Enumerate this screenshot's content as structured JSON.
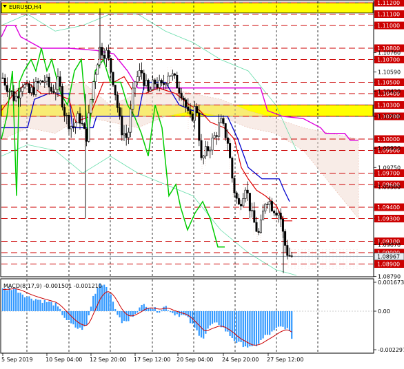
{
  "chart_window": {
    "title": "EURUSD,H4",
    "symbol": "EURUSD",
    "timeframe": "H4",
    "price_axis": {
      "plain_ticks": [
        "1.10760",
        "1.10590",
        "1.10420",
        "1.10200",
        "1.09920",
        "1.09750",
        "1.09580",
        "1.09070",
        "1.08790"
      ],
      "current_price": "1.08967"
    },
    "levels": [
      {
        "label": "1.11200",
        "value": 1.112
      },
      {
        "label": "1.11100",
        "value": 1.111
      },
      {
        "label": "1.11000",
        "value": 1.11
      },
      {
        "label": "1.10800",
        "value": 1.108
      },
      {
        "label": "1.10700",
        "value": 1.107
      },
      {
        "label": "1.10500",
        "value": 1.105
      },
      {
        "label": "1.10400",
        "value": 1.104
      },
      {
        "label": "1.10300",
        "value": 1.103
      },
      {
        "label": "1.10200",
        "value": 1.102
      },
      {
        "label": "1.10000",
        "value": 1.1
      },
      {
        "label": "1.09900",
        "value": 1.099
      },
      {
        "label": "1.09700",
        "value": 1.097
      },
      {
        "label": "1.09600",
        "value": 1.096
      },
      {
        "label": "1.09400",
        "value": 1.094
      },
      {
        "label": "1.09300",
        "value": 1.093
      },
      {
        "label": "1.09100",
        "value": 1.091
      },
      {
        "label": "1.09000",
        "value": 1.09
      },
      {
        "label": "1.08900",
        "value": 1.089
      }
    ],
    "zones": [
      {
        "from": 1.1111,
        "to": 1.112
      },
      {
        "from": 1.102,
        "to": 1.103
      }
    ],
    "time_labels": [
      "5 Sep 2019",
      "10 Sep 04:00",
      "12 Sep 20:00",
      "17 Sep 12:00",
      "20 Sep 04:00",
      "24 Sep 20:00",
      "27 Sep 12:00"
    ],
    "colors": {
      "level_line": "#cc0000",
      "level_tag_bg": "#cc0000",
      "zone": "#ffff00",
      "zone_border": "#000000",
      "ichimoku_kijun": "#0000cc",
      "ichimoku_tenkan": "#dd0000",
      "ichimoku_senkou_b": "#dd00dd",
      "chikou": "#00cc00",
      "bollinger": "#66ddaa",
      "macd_hist": "#3399ff",
      "macd_signal": "#cc0000",
      "candles": "#000000"
    }
  },
  "macd_panel": {
    "title": "MACD(8,17,9) -0.001501 -0.001210",
    "label": "MACD(8,17,9)",
    "main_value": "-0.001501",
    "signal_value": "-0.001210",
    "scale_top": "0.001673",
    "scale_zero": "0.00",
    "scale_bottom": "-0.002297"
  }
}
